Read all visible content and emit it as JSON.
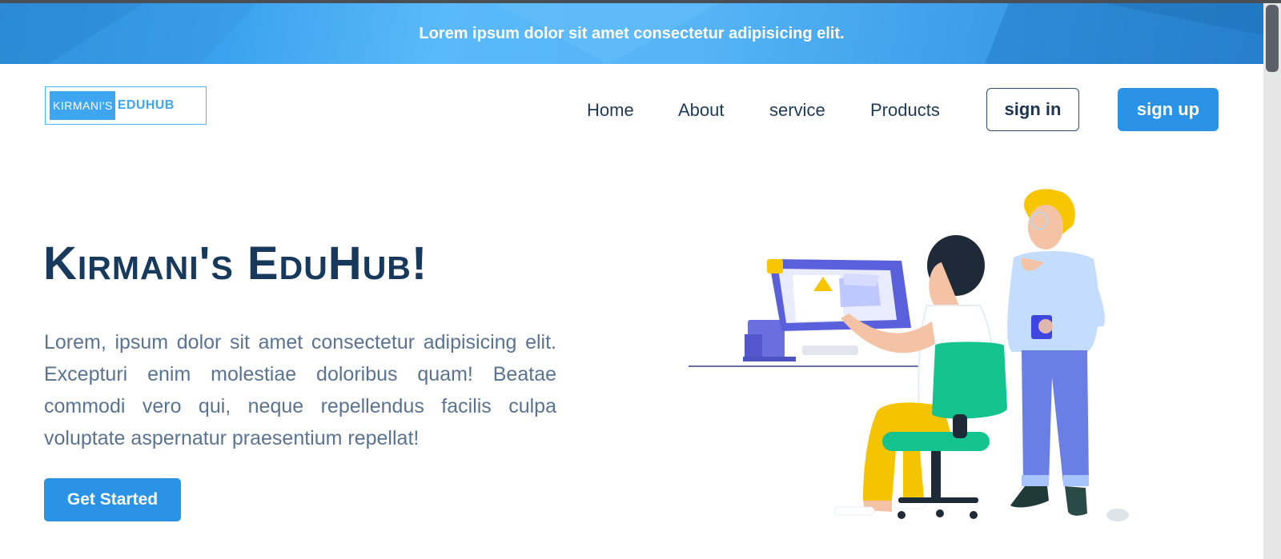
{
  "announcement": {
    "text": "Lorem ipsum dolor sit amet consectetur adipisicing elit."
  },
  "logo": {
    "part1": "KIRMANI'S",
    "part2": "EDUHUB"
  },
  "nav": {
    "items": [
      "Home",
      "About",
      "service",
      "Products"
    ],
    "sign_in": "sign in",
    "sign_up": "sign up"
  },
  "hero": {
    "title": "Kirmani's EduHub!",
    "text": "Lorem, ipsum dolor sit amet consectetur adipisicing elit. Excepturi enim molestiae doloribus quam! Beatae commodi vero qui, neque repellendus facilis culpa voluptate aspernatur praesentium repellat!",
    "cta": "Get Started"
  },
  "colors": {
    "primary": "#2a93e6",
    "heading": "#173a5c",
    "body_text": "#5a7391",
    "announcement_bg": "#3aa2ee"
  }
}
